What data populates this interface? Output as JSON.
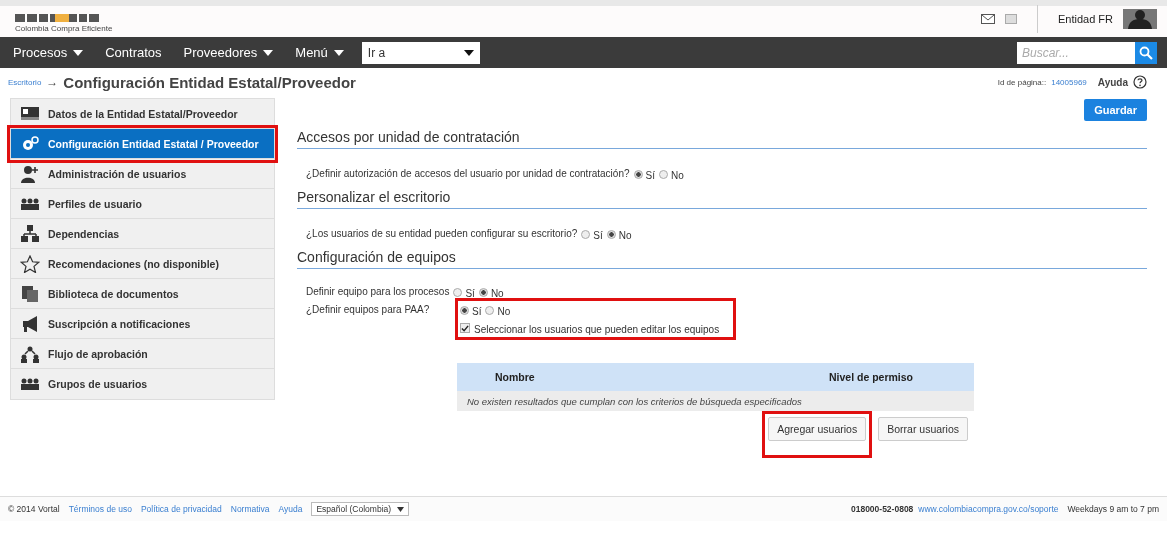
{
  "header": {
    "logo_text": "Colombia Compra Eficiente",
    "user_name": "Entidad FR"
  },
  "nav": {
    "items": [
      {
        "label": "Procesos",
        "dropdown": true
      },
      {
        "label": "Contratos",
        "dropdown": false
      },
      {
        "label": "Proveedores",
        "dropdown": true
      },
      {
        "label": "Menú",
        "dropdown": true
      }
    ],
    "goto": {
      "value": "Ir a"
    },
    "search": {
      "placeholder": "Buscar..."
    }
  },
  "breadcrumb": {
    "link": "Escritorio",
    "separator": "→",
    "title": "Configuración Entidad Estatal/Proveedor",
    "page_id_label": "Id de página::",
    "page_id": "14005969",
    "help": "Ayuda"
  },
  "sidebar": {
    "items": [
      {
        "label": "Datos de la Entidad Estatal/Proveedor",
        "kind": "card",
        "selected": false,
        "highlighted": false
      },
      {
        "label": "Configuración Entidad Estatal / Proveedor",
        "kind": "gears",
        "selected": true,
        "highlighted": true
      },
      {
        "label": "Administración de usuarios",
        "kind": "user-add",
        "selected": false,
        "highlighted": false
      },
      {
        "label": "Perfiles de usuario",
        "kind": "users",
        "selected": false,
        "highlighted": false
      },
      {
        "label": "Dependencias",
        "kind": "org",
        "selected": false,
        "highlighted": false
      },
      {
        "label": "Recomendaciones (no disponible)",
        "kind": "star",
        "selected": false,
        "highlighted": false
      },
      {
        "label": "Biblioteca de documentos",
        "kind": "docs",
        "selected": false,
        "highlighted": false
      },
      {
        "label": "Suscripción a notificaciones",
        "kind": "megaphone",
        "selected": false,
        "highlighted": false
      },
      {
        "label": "Flujo de aprobación",
        "kind": "flow",
        "selected": false,
        "highlighted": false
      },
      {
        "label": "Grupos de usuarios",
        "kind": "users",
        "selected": false,
        "highlighted": false
      }
    ]
  },
  "save_button": "Guardar",
  "sections": [
    {
      "title": "Accesos por unidad de contratación",
      "questions": [
        {
          "label": "¿Definir autorización de accesos del usuario por unidad de contratación?",
          "highlighted": false,
          "options": [
            {
              "label": "Sí",
              "selected": true
            },
            {
              "label": "No",
              "selected": false
            }
          ]
        }
      ]
    },
    {
      "title": "Personalizar el escritorio",
      "questions": [
        {
          "label": "¿Los usuarios de su entidad pueden configurar su escritorio?",
          "highlighted": false,
          "options": [
            {
              "label": "Sí",
              "selected": false
            },
            {
              "label": "No",
              "selected": true
            }
          ]
        }
      ]
    },
    {
      "title": "Configuración de equipos",
      "questions": [
        {
          "label": "Definir equipo para los procesos",
          "highlighted": false,
          "options": [
            {
              "label": "Sí",
              "selected": false
            },
            {
              "label": "No",
              "selected": true
            }
          ]
        },
        {
          "label": "¿Definir equipos para PAA?",
          "highlighted": true,
          "options": [
            {
              "label": "Sí",
              "selected": true
            },
            {
              "label": "No",
              "selected": false
            }
          ],
          "checkbox": {
            "label": "Seleccionar los usuarios que pueden editar los equipos",
            "checked": true
          }
        }
      ]
    }
  ],
  "table": {
    "columns": [
      "Nombre",
      "Nivel de permiso"
    ],
    "empty_message": "No existen resultados que cumplan con los criterios de búsqueda especificados"
  },
  "buttons": [
    {
      "label": "Agregar usuarios",
      "highlighted": true
    },
    {
      "label": "Borrar usuarios",
      "highlighted": false
    }
  ],
  "footer": {
    "copyright": "© 2014 Vortal",
    "links": [
      "Términos de uso",
      "Política de privacidad",
      "Normativa",
      "Ayuda"
    ],
    "language": "Español (Colombia)",
    "phone": "018000-52-0808",
    "support_link": "www.colombiacompra.gov.co/soporte",
    "hours": "Weekdays 9 am to 7 pm"
  }
}
